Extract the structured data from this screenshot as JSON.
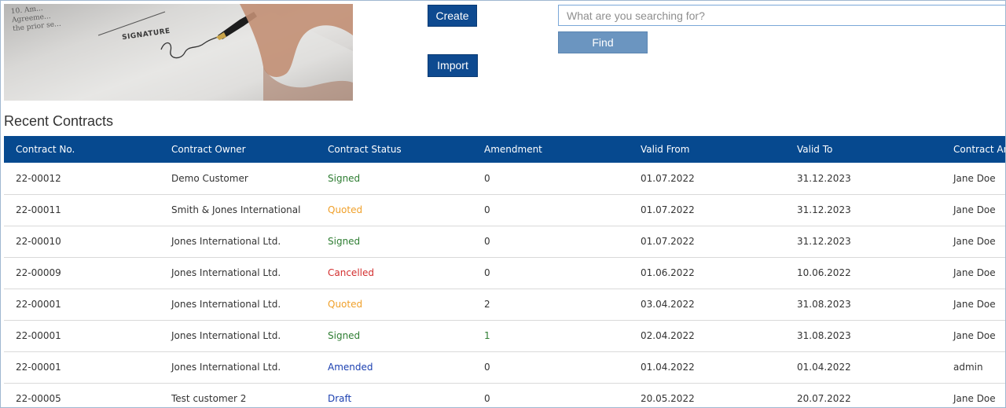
{
  "hero": {
    "caption_lines": [
      "10. Am...",
      "Agreeme...",
      "the prior se..."
    ],
    "signature_label": "SIGNATURE"
  },
  "actions": {
    "create_label": "Create",
    "import_label": "Import",
    "find_label": "Find",
    "search_placeholder": "What are you searching for?"
  },
  "section": {
    "title": "Recent Contracts"
  },
  "table": {
    "headers": [
      "Contract No.",
      "Contract Owner",
      "Contract Status",
      "Amendment",
      "Valid From",
      "Valid To",
      "Contract Analyst"
    ],
    "rows": [
      {
        "no": "22-00012",
        "owner": "Demo Customer",
        "status": "Signed",
        "status_class": "st-signed",
        "amendment": "0",
        "valid_from": "01.07.2022",
        "valid_to": "31.12.2023",
        "analyst": "Jane Doe"
      },
      {
        "no": "22-00011",
        "owner": "Smith & Jones International",
        "status": "Quoted",
        "status_class": "st-quoted",
        "amendment": "0",
        "valid_from": "01.07.2022",
        "valid_to": "31.12.2023",
        "analyst": "Jane Doe"
      },
      {
        "no": "22-00010",
        "owner": "Jones International Ltd.",
        "status": "Signed",
        "status_class": "st-signed",
        "amendment": "0",
        "valid_from": "01.07.2022",
        "valid_to": "31.12.2023",
        "analyst": "Jane Doe"
      },
      {
        "no": "22-00009",
        "owner": "Jones International Ltd.",
        "status": "Cancelled",
        "status_class": "st-cancelled",
        "amendment": "0",
        "valid_from": "01.06.2022",
        "valid_to": "10.06.2022",
        "analyst": "Jane Doe"
      },
      {
        "no": "22-00001",
        "owner": "Jones International Ltd.",
        "status": "Quoted",
        "status_class": "st-quoted",
        "amendment": "2",
        "valid_from": "03.04.2022",
        "valid_to": "31.08.2023",
        "analyst": "Jane Doe"
      },
      {
        "no": "22-00001",
        "owner": "Jones International Ltd.",
        "status": "Signed",
        "status_class": "st-signed",
        "amendment": "1",
        "valid_from": "02.04.2022",
        "valid_to": "31.08.2023",
        "analyst": "Jane Doe"
      },
      {
        "no": "22-00001",
        "owner": "Jones International Ltd.",
        "status": "Amended",
        "status_class": "st-amended",
        "amendment": "0",
        "valid_from": "01.04.2022",
        "valid_to": "01.04.2022",
        "analyst": "admin"
      },
      {
        "no": "22-00005",
        "owner": "Test customer 2",
        "status": "Draft",
        "status_class": "st-draft",
        "amendment": "0",
        "valid_from": "20.05.2022",
        "valid_to": "20.07.2022",
        "analyst": "Jane Doe"
      }
    ]
  },
  "colors": {
    "header_bg": "#06498f",
    "button_bg": "#0e4a90",
    "find_bg": "#6b95c0",
    "signed": "#2e7d32",
    "quoted": "#f0a02a",
    "cancelled": "#d32f2f",
    "amended": "#1a3fb0"
  }
}
